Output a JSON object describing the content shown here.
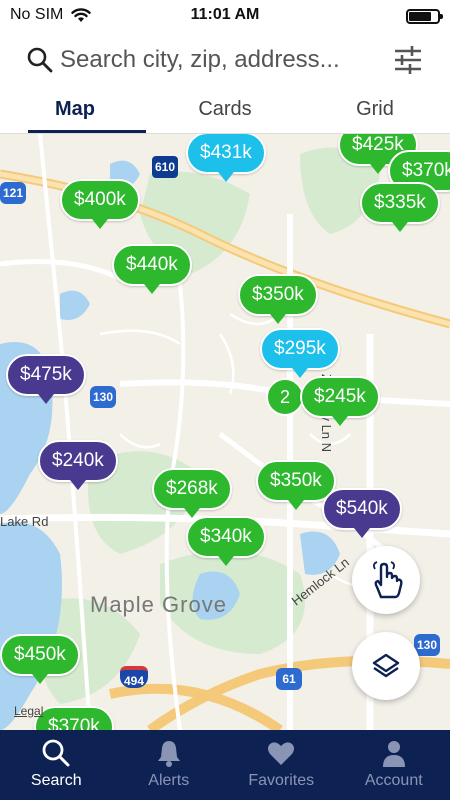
{
  "status_bar": {
    "carrier": "No SIM",
    "time": "11:01 AM"
  },
  "search": {
    "placeholder": "Search city, zip, address..."
  },
  "tabs": [
    {
      "label": "Map",
      "active": true
    },
    {
      "label": "Cards",
      "active": false
    },
    {
      "label": "Grid",
      "active": false
    }
  ],
  "map": {
    "area_label": "Maple Grove",
    "road_labels": [
      "Lake Rd",
      "Hemlock Ln",
      "Zachary Ln N"
    ],
    "highway_shields": [
      "610",
      "121",
      "130",
      "494",
      "61",
      "130"
    ],
    "legal_label": "Legal",
    "pins": [
      {
        "price": "$431k",
        "color": "cyan"
      },
      {
        "price": "$425k",
        "color": "green"
      },
      {
        "price": "$370k",
        "color": "green"
      },
      {
        "price": "$400k",
        "color": "green"
      },
      {
        "price": "$335k",
        "color": "green"
      },
      {
        "price": "$440k",
        "color": "green"
      },
      {
        "price": "$350k",
        "color": "green"
      },
      {
        "price": "$295k",
        "color": "cyan"
      },
      {
        "price": "$475k",
        "color": "purple"
      },
      {
        "price": "$245k",
        "color": "green"
      },
      {
        "price": "$240k",
        "color": "purple"
      },
      {
        "price": "$268k",
        "color": "green"
      },
      {
        "price": "$350k",
        "color": "green"
      },
      {
        "price": "$540k",
        "color": "purple"
      },
      {
        "price": "$340k",
        "color": "green"
      },
      {
        "price": "$450k",
        "color": "green"
      },
      {
        "price": "$370k",
        "color": "green"
      }
    ],
    "cluster_count": "2",
    "colors": {
      "green": "#2eb82e",
      "cyan": "#1cc0ea",
      "purple": "#4a3a8f"
    }
  },
  "fabs": {
    "draw": "hand-pointer-icon",
    "layers": "layers-icon"
  },
  "bottom_nav": [
    {
      "label": "Search",
      "icon": "search-icon",
      "active": true
    },
    {
      "label": "Alerts",
      "icon": "bell-icon",
      "active": false
    },
    {
      "label": "Favorites",
      "icon": "heart-icon",
      "active": false
    },
    {
      "label": "Account",
      "icon": "person-icon",
      "active": false
    }
  ],
  "brand_colors": {
    "navy": "#0d2152"
  }
}
